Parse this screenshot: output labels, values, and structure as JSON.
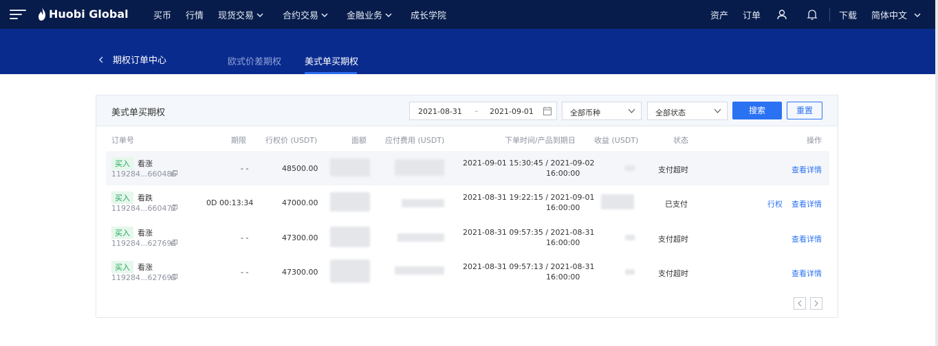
{
  "topnav": {
    "logo": "Huobi Global",
    "items": [
      {
        "label": "买币",
        "dropdown": false
      },
      {
        "label": "行情",
        "dropdown": false
      },
      {
        "label": "现货交易",
        "dropdown": true
      },
      {
        "label": "合约交易",
        "dropdown": true
      },
      {
        "label": "金融业务",
        "dropdown": true
      },
      {
        "label": "成长学院",
        "dropdown": false
      }
    ],
    "right": {
      "assets": "资产",
      "orders": "订单",
      "user_icon": "user-icon",
      "bell_icon": "bell-icon",
      "download": "下载",
      "language": "简体中文"
    }
  },
  "header": {
    "back_icon": "chevron-left-icon",
    "title": "期权订单中心",
    "tabs": [
      {
        "label": "欧式价差期权",
        "active": false
      },
      {
        "label": "美式单买期权",
        "active": true
      }
    ]
  },
  "panel": {
    "title": "美式单买期权",
    "date_start": "2021-08-31",
    "date_separator": "–",
    "date_end": "2021-09-01",
    "currency_select": "全部币种",
    "status_select": "全部状态",
    "search_button": "搜索",
    "reset_button": "重置"
  },
  "table": {
    "headers": {
      "order_no": "订单号",
      "term": "期限",
      "strike": "行权价 (USDT)",
      "face_value": "面额",
      "fee": "应付费用 (USDT)",
      "time": "下单时间/产品到期日",
      "profit": "收益 (USDT)",
      "status": "状态",
      "action": "操作"
    },
    "rows": [
      {
        "side": "买入",
        "direction": "看涨",
        "order_id": "119284...660486",
        "term": "- -",
        "strike": "48500.00",
        "time_line1": "2021-09-01 15:30:45 / 2021-09-02",
        "time_line2": "16:00:00",
        "status": "支付超时",
        "exercise": "",
        "details": "查看详情"
      },
      {
        "side": "买入",
        "direction": "看跌",
        "order_id": "119284...660477",
        "term": "0D 00:13:34",
        "strike": "47000.00",
        "time_line1": "2021-08-31 19:22:15 / 2021-09-01",
        "time_line2": "16:00:00",
        "status": "已支付",
        "exercise": "行权",
        "details": "查看详情"
      },
      {
        "side": "买入",
        "direction": "看涨",
        "order_id": "119284...627694",
        "term": "- -",
        "strike": "47300.00",
        "time_line1": "2021-08-31 09:57:35 / 2021-08-31",
        "time_line2": "16:00:00",
        "status": "支付超时",
        "exercise": "",
        "details": "查看详情"
      },
      {
        "side": "买入",
        "direction": "看涨",
        "order_id": "119284...627693",
        "term": "- -",
        "strike": "47300.00",
        "time_line1": "2021-08-31 09:57:13 / 2021-08-31",
        "time_line2": "16:00:00",
        "status": "支付超时",
        "exercise": "",
        "details": "查看详情"
      }
    ]
  },
  "pagination": {
    "prev_icon": "chevron-left-icon",
    "next_icon": "chevron-right-icon"
  },
  "colors": {
    "nav_bg": "#071c4a",
    "band_bg": "#0a2b8e",
    "accent": "#2b72f3",
    "buy_green": "#1ea65a"
  }
}
